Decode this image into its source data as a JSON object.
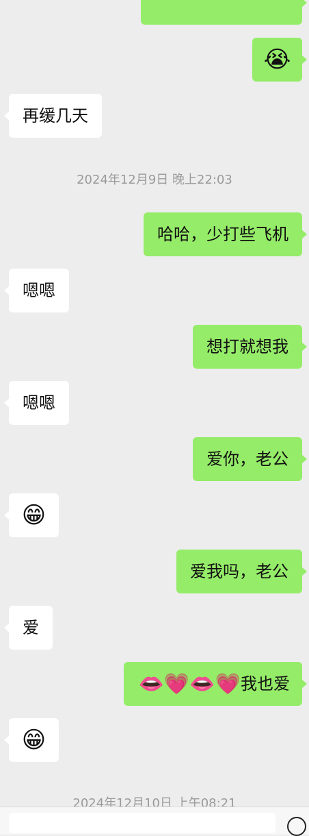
{
  "messages": [
    {
      "side": "sent",
      "text": "",
      "note_hidden": true
    },
    {
      "side": "sent",
      "emoji": "😭"
    },
    {
      "side": "recv",
      "text": "再缓几天"
    },
    {
      "timestamp": "2024年12月9日 晚上22:03"
    },
    {
      "side": "sent",
      "text": "哈哈，少打些飞机"
    },
    {
      "side": "recv",
      "text": "嗯嗯"
    },
    {
      "side": "sent",
      "text": "想打就想我"
    },
    {
      "side": "recv",
      "text": "嗯嗯"
    },
    {
      "side": "sent",
      "text": "爱你，老公"
    },
    {
      "side": "recv",
      "emoji": "😁"
    },
    {
      "side": "sent",
      "text": "爱我吗，老公"
    },
    {
      "side": "recv",
      "text": "爱"
    },
    {
      "side": "sent",
      "emojis": [
        "👄",
        "💗",
        "👄",
        "💗"
      ],
      "text": "我也爱"
    },
    {
      "side": "recv",
      "emoji": "😁"
    }
  ],
  "timestamps": {
    "t1": "2024年12月9日 晚上22:03",
    "t2": "2024年12月10日 上午08:21"
  },
  "colors": {
    "background": "#ededed",
    "sent_bubble": "#95ec69",
    "recv_bubble": "#ffffff",
    "timestamp_text": "#9a9a9a"
  },
  "icons": {
    "cry": "😭",
    "grin": "😁",
    "kiss": "👄",
    "heart": "💗"
  }
}
